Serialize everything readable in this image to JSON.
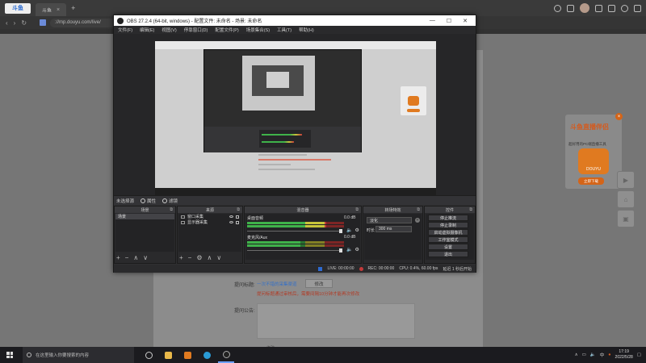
{
  "browser": {
    "logo_text": "斗鱼",
    "tabs": [
      {
        "label": "斗鱼"
      }
    ],
    "address": "://mp.douyu.com/live/",
    "colors": {
      "chrome": "#3a3a3a",
      "accent": "#2a6bd1"
    }
  },
  "page": {
    "tip_label": "提问标题:",
    "tip_link": "一次不错的采集渠道",
    "tip_btn": "修改",
    "tip_warning": "提问标题通过审核后，需要间隔10分钟才能再次修改",
    "notice_label": "提问公告:",
    "bottom_text": "修改",
    "ad": {
      "title": "斗鱼直播伴侣",
      "subtitle": "超好用的PC端直播工具",
      "logo_text": "DOUYU",
      "download": "立即下载",
      "close": "×"
    }
  },
  "obs": {
    "title": "OBS 27.2.4 (64-bit, windows) - 配置文件: 未命名 - 场景: 未命名",
    "menu": [
      "文件(F)",
      "编辑(E)",
      "视图(V)",
      "停靠窗口(D)",
      "配置文件(P)",
      "场景集合(S)",
      "工具(T)",
      "帮助(H)"
    ],
    "scene_status": "未选择源",
    "properties_btn": "属性",
    "filters_btn": "滤镜",
    "docks": {
      "scenes": {
        "title": "场景",
        "items": [
          "场景"
        ]
      },
      "sources": {
        "title": "来源",
        "items": [
          "窗口采集",
          "显示器采集"
        ]
      },
      "mixer": {
        "title": "混音器",
        "channels": [
          {
            "name": "桌面音频",
            "db": "0.0 dB",
            "level": 0.82
          },
          {
            "name": "麦克风/Aux",
            "db": "0.0 dB",
            "level": 0.55
          }
        ]
      },
      "transitions": {
        "title": "转场特效",
        "select": "淡化",
        "duration_label": "时长",
        "duration": "300 ms"
      },
      "controls": {
        "title": "控件",
        "buttons": [
          "停止推流",
          "停止录制",
          "启动虚拟摄像机",
          "工作室模式",
          "设置",
          "退出"
        ]
      }
    },
    "status": {
      "live": "LIVE: 00:00:00",
      "rec": "REC: 00:00:00",
      "cpu": "CPU: 0.4%, 60.00 fps",
      "stream": "延迟 1 秒后开始"
    }
  },
  "taskbar": {
    "search_placeholder": "在这里输入你要搜索的内容",
    "time": "17:19",
    "date": "2022/5/28",
    "lang": "中"
  }
}
